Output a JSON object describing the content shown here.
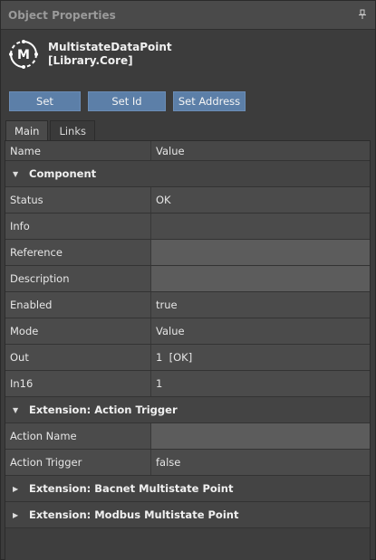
{
  "panel": {
    "title": "Object Properties"
  },
  "object": {
    "name_line1": "MultistateDataPoint",
    "name_line2": "[Library.Core]",
    "logo_letter": "M"
  },
  "buttons": [
    "Set",
    "Set Id",
    "Set Address"
  ],
  "tabs": [
    "Main",
    "Links"
  ],
  "columns": {
    "name": "Name",
    "value": "Value"
  },
  "sections": {
    "component": "Component",
    "action_trigger": "Extension: Action Trigger",
    "bacnet": "Extension: Bacnet Multistate Point",
    "modbus": "Extension: Modbus Multistate Point"
  },
  "component_rows": [
    {
      "name": "Status",
      "value": "OK"
    },
    {
      "name": "Info",
      "value": ""
    },
    {
      "name": "Reference",
      "value": ""
    },
    {
      "name": "Description",
      "value": ""
    },
    {
      "name": "Enabled",
      "value": "true"
    },
    {
      "name": "Mode",
      "value": "Value"
    },
    {
      "name": "Out",
      "value": "1  [OK]"
    },
    {
      "name": "In16",
      "value": "1"
    }
  ],
  "action_rows": [
    {
      "name": "Action Name",
      "value": ""
    },
    {
      "name": "Action Trigger",
      "value": "false"
    }
  ],
  "colors": {
    "button": "#5c7fa8",
    "panel_bg": "#3c3c3c",
    "empty_cell": "#5c5c5c"
  }
}
